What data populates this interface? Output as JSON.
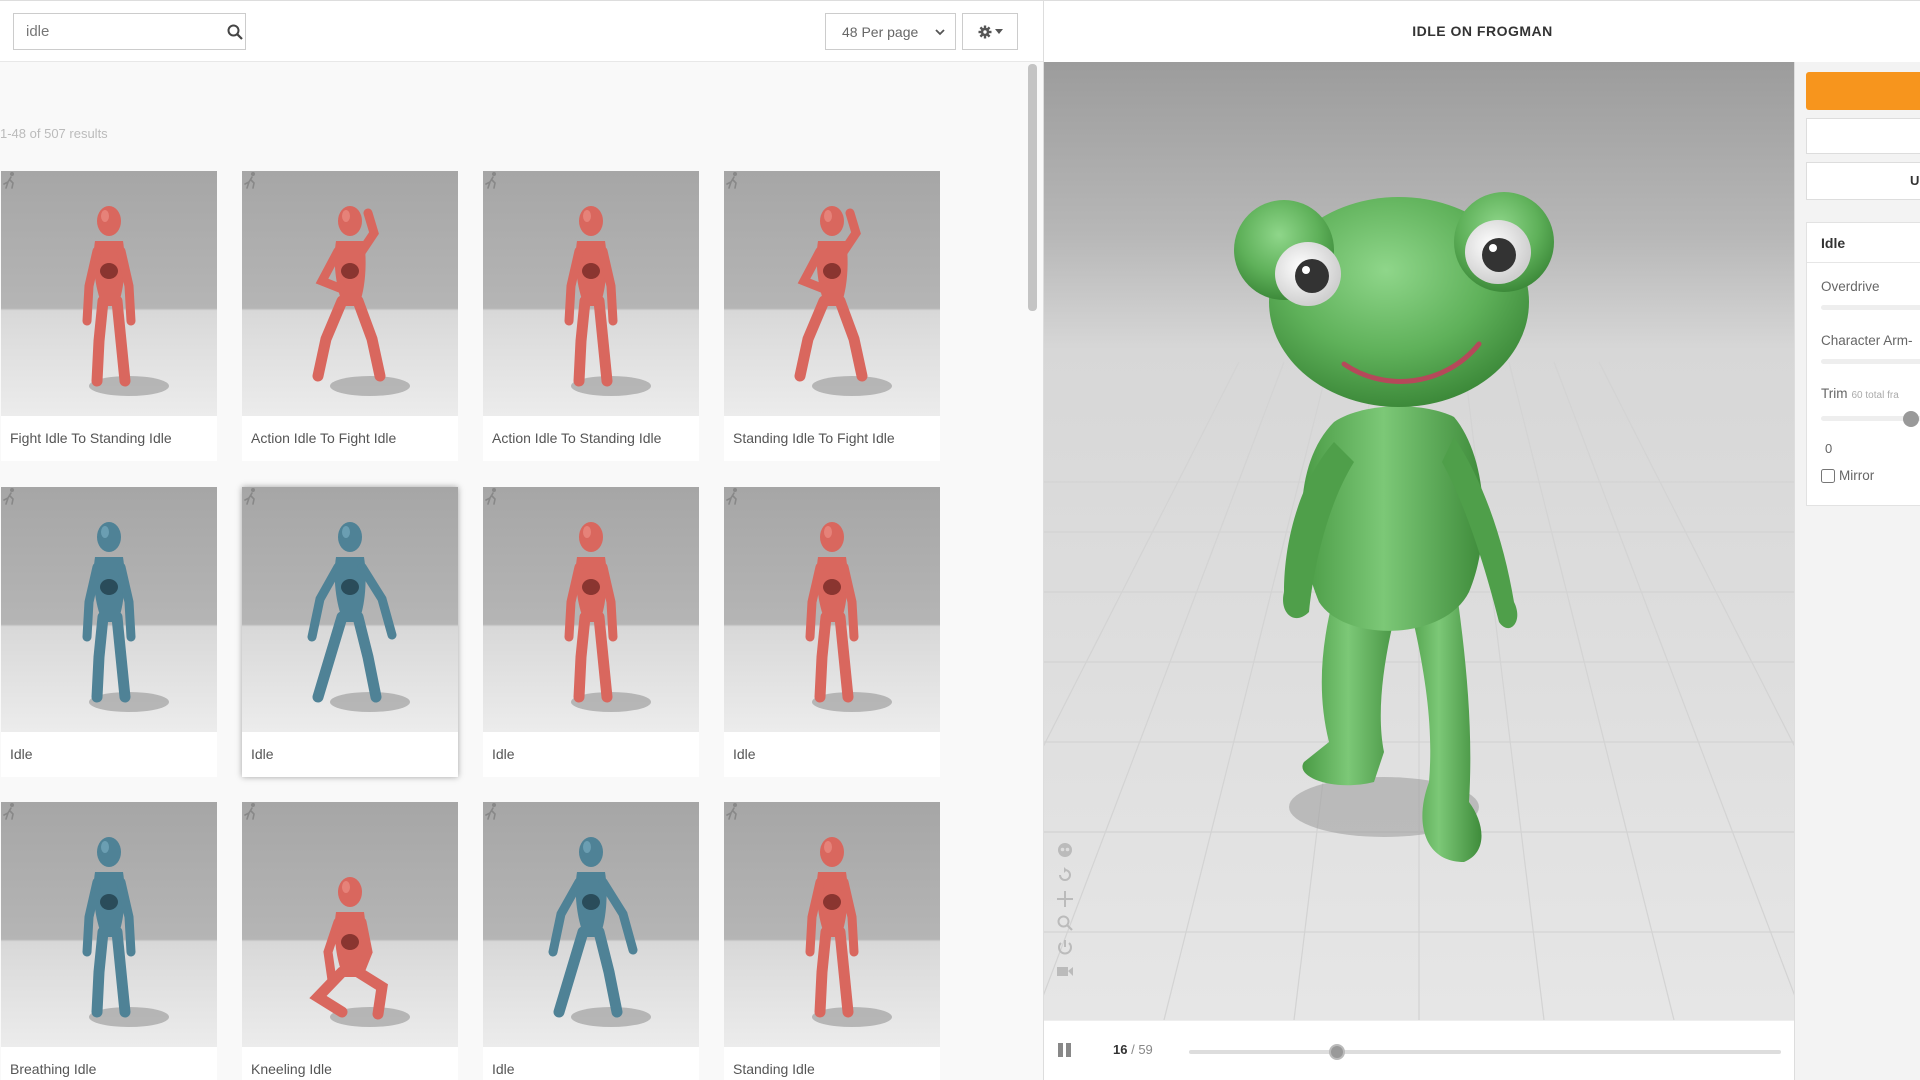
{
  "search": {
    "value": "idle"
  },
  "per_page": {
    "selected": "48 Per page"
  },
  "results_count": "1-48 of 507 results",
  "cards": [
    {
      "label": "Fight Idle To Standing Idle",
      "color": "red",
      "pose": "stand"
    },
    {
      "label": "Action Idle To Fight Idle",
      "color": "red",
      "pose": "fight"
    },
    {
      "label": "Action Idle To Standing Idle",
      "color": "red",
      "pose": "stand"
    },
    {
      "label": "Standing Idle To Fight Idle",
      "color": "red",
      "pose": "fight"
    },
    {
      "label": "Idle",
      "color": "blue",
      "pose": "stand"
    },
    {
      "label": "Idle",
      "color": "blue",
      "pose": "wide"
    },
    {
      "label": "Idle",
      "color": "red",
      "pose": "stand"
    },
    {
      "label": "Idle",
      "color": "red",
      "pose": "stand"
    },
    {
      "label": "Breathing Idle",
      "color": "blue",
      "pose": "stand"
    },
    {
      "label": "Kneeling Idle",
      "color": "red",
      "pose": "kneel"
    },
    {
      "label": "Idle",
      "color": "blue",
      "pose": "wide"
    },
    {
      "label": "Standing Idle",
      "color": "red",
      "pose": "stand"
    }
  ],
  "viewer": {
    "title": "IDLE ON FROGMAN",
    "frame_current": "16",
    "frame_total": "/ 59",
    "playback_progress": 0.25
  },
  "settings": {
    "upload_label": "U",
    "panel_title": "Idle",
    "overdrive_label": "Overdrive",
    "arm_space_label": "Character Arm-",
    "trim_label": "Trim",
    "trim_sub": "60 total fra",
    "trim_start": "0",
    "mirror_label": "Mirror"
  },
  "colors": {
    "accent": "#f7951d",
    "red_model": "#d9675e",
    "blue_model": "#4f8296",
    "frog": "#5fb15a"
  },
  "icons": [
    "search-icon",
    "gear-icon",
    "chevron-down-icon",
    "animation-icon",
    "skeleton-icon",
    "rotate-icon",
    "pan-icon",
    "zoom-icon",
    "power-icon",
    "camera-icon",
    "pause-icon"
  ]
}
